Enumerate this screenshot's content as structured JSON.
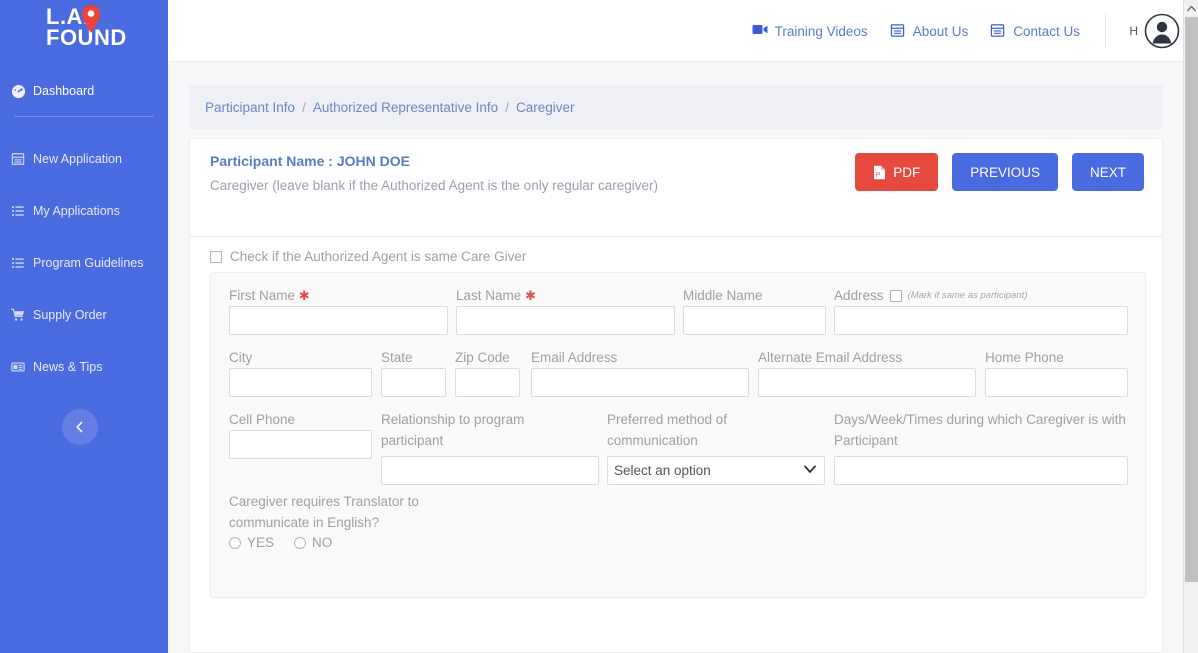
{
  "brand": {
    "line1": "L.A.",
    "line2": "FOUND",
    "pin_icon": "map-pin-icon"
  },
  "sidebar": {
    "items": [
      {
        "label": "Dashboard",
        "icon": "dashboard-gauge-icon",
        "active": true
      },
      {
        "label": "New Application",
        "icon": "new-application-icon",
        "active": false
      },
      {
        "label": "My Applications",
        "icon": "list-icon",
        "active": false
      },
      {
        "label": "Program Guidelines",
        "icon": "list-icon",
        "active": false
      },
      {
        "label": "Supply Order",
        "icon": "shopping-cart-icon",
        "active": false
      },
      {
        "label": "News & Tips",
        "icon": "news-icon",
        "active": false
      }
    ],
    "collapse_icon": "chevron-left-icon"
  },
  "topbar": {
    "links": [
      {
        "label": "Training Videos",
        "icon": "video-camera-icon"
      },
      {
        "label": "About Us",
        "icon": "document-icon"
      },
      {
        "label": "Contact Us",
        "icon": "document-icon"
      }
    ],
    "user_initial": "H",
    "avatar_icon": "user-avatar-icon"
  },
  "breadcrumb": {
    "items": [
      "Participant Info",
      "Authorized Representative Info",
      "Caregiver"
    ],
    "separator": "/"
  },
  "card": {
    "participant_name_label": "Participant Name : JOHN DOE",
    "section_note": "Caregiver (leave blank if the Authorized Agent is the only regular caregiver)",
    "buttons": {
      "pdf": "PDF",
      "pdf_icon": "pdf-file-icon",
      "previous": "PREVIOUS",
      "next": "NEXT"
    },
    "same_as_agent_checkbox_label": "Check if the Authorized Agent is same Care Giver"
  },
  "form": {
    "row1": {
      "first_name": {
        "label": "First Name",
        "required": "✱",
        "value": "",
        "placeholder": ""
      },
      "last_name": {
        "label": "Last Name",
        "required": "✱",
        "value": "",
        "placeholder": ""
      },
      "middle_name": {
        "label": "Middle Name",
        "value": "",
        "placeholder": ""
      },
      "address": {
        "label": "Address",
        "hint": "(Mark if same as participant)",
        "value": "",
        "placeholder": ""
      }
    },
    "row2": {
      "city": {
        "label": "City",
        "value": "",
        "placeholder": ""
      },
      "state": {
        "label": "State",
        "value": "",
        "placeholder": ""
      },
      "zip_code": {
        "label": "Zip Code",
        "value": "",
        "placeholder": ""
      },
      "email_address": {
        "label": "Email Address",
        "value": "",
        "placeholder": ""
      },
      "alternate_email": {
        "label": "Alternate Email Address",
        "value": "",
        "placeholder": ""
      },
      "home_phone": {
        "label": "Home Phone",
        "value": "",
        "placeholder": ""
      }
    },
    "row3": {
      "cell_phone": {
        "label": "Cell Phone",
        "value": "",
        "placeholder": ""
      },
      "relationship": {
        "label": "Relationship to program participant",
        "value": "",
        "placeholder": ""
      },
      "preferred_method": {
        "label": "Preferred method of communication",
        "selected": "Select an option",
        "options": [
          "Select an option"
        ],
        "arrow_icon": "chevron-down-icon"
      },
      "days_times": {
        "label": "Days/Week/Times during which Caregiver is with Participant",
        "value": "",
        "placeholder": ""
      }
    },
    "translator": {
      "label": "Caregiver requires Translator to communicate in English?",
      "options": [
        "YES",
        "NO"
      ]
    }
  },
  "scrollbar": {
    "up_icon": "chevron-up-icon"
  },
  "colors": {
    "sidebar": "#4a6ae0",
    "primary": "#4a6ae0",
    "danger": "#e64a3e",
    "breadcrumb_text": "#6b86c4",
    "label_gray": "#a0a0a0"
  }
}
